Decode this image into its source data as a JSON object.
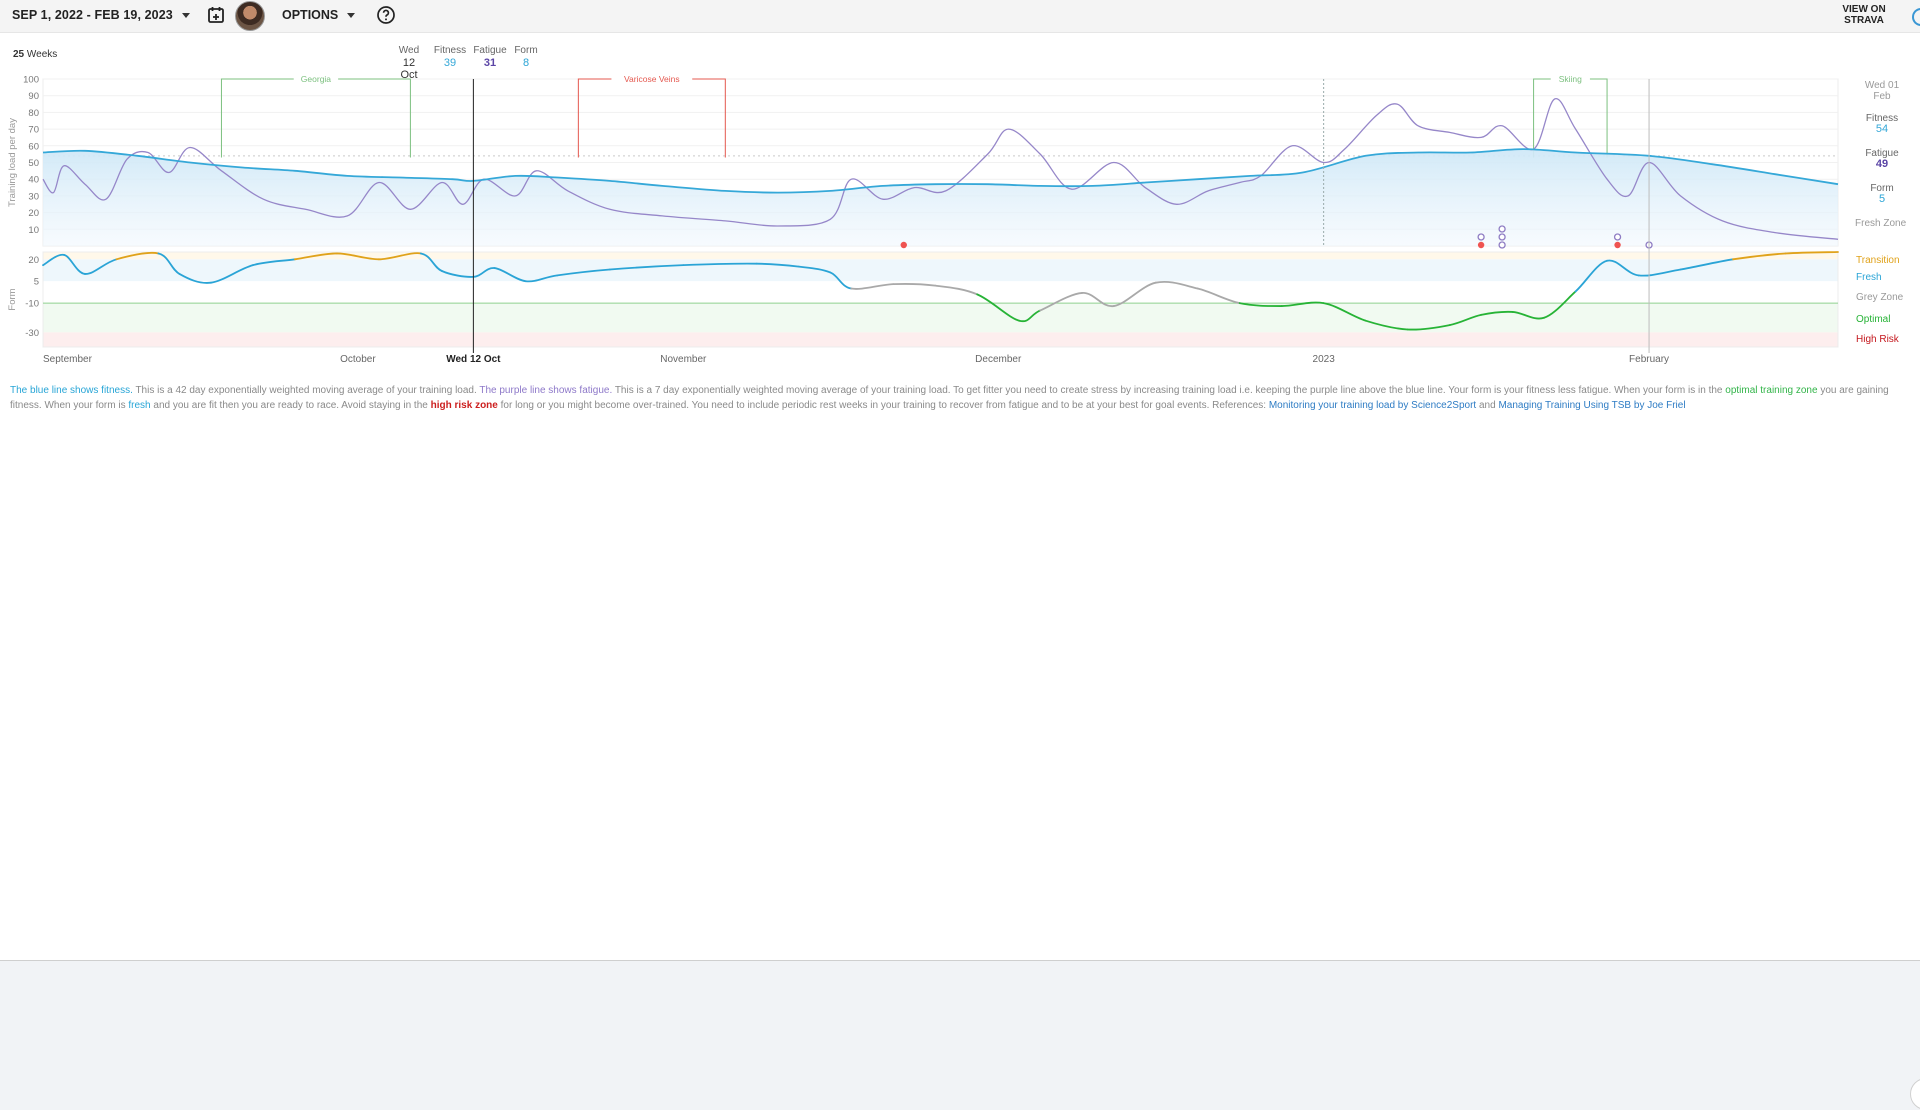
{
  "toolbar": {
    "date_range": "SEP 1, 2022 - FEB 19, 2023",
    "options_label": "OPTIONS",
    "strava_line1": "VIEW ON",
    "strava_line2": "STRAVA"
  },
  "summary": {
    "weeks_count": "25",
    "weeks_label": "Weeks"
  },
  "hover": {
    "day": "Wed",
    "date": "12 Oct",
    "fitness_label": "Fitness",
    "fitness": "39",
    "fatigue_label": "Fatigue",
    "fatigue": "31",
    "form_label": "Form",
    "form": "8",
    "axis_label": "Wed 12 Oct"
  },
  "latest": {
    "date_line1": "Wed 01",
    "date_line2": "Feb",
    "fitness_label": "Fitness",
    "fitness": "54",
    "fatigue_label": "Fatigue",
    "fatigue": "49",
    "form_label": "Form",
    "form": "5"
  },
  "zones": {
    "fresh_zone": "Fresh Zone",
    "transition": "Transition",
    "fresh": "Fresh",
    "grey": "Grey Zone",
    "optimal": "Optimal",
    "high_risk": "High Risk"
  },
  "colors": {
    "fitness": "#35a8d8",
    "fatigue": "#9687c9",
    "transition": "#e0a21a",
    "fresh": "#2aa4d6",
    "grey": "#a9a9a9",
    "optimal": "#27b336",
    "high_risk": "#c4161c",
    "event_green": "#7cc07f",
    "event_red": "#e4584f",
    "marker_red": "#ef5350",
    "marker_purple": "#8e7cc3"
  },
  "description": {
    "fitness_phrase": "The blue line shows fitness.",
    "p1": " This is a 42 day exponentially weighted moving average of your training load. ",
    "fatigue_phrase": "The purple line shows fatigue.",
    "p2": " This is a 7 day exponentially weighted moving average of your training load. To get fitter you need to create stress by increasing training load i.e. keeping the purple line above the blue line. Your form is your fitness less fatigue. When your form is in the ",
    "optimal_phrase": "optimal training zone",
    "p3": " you are gaining fitness. When your form is ",
    "fresh_phrase": "fresh",
    "p4": " and you are fit then you are ready to race. Avoid staying in the ",
    "risk_phrase": "high risk zone",
    "p5": " for long or you might become over-trained. You need to include periodic rest weeks in your training to recover from fatigue and to be at your best for goal events. References: ",
    "ref1": "Monitoring your training load by Science2Sport",
    "and": " and ",
    "ref2": "Managing Training Using TSB by Joe Friel"
  },
  "chart_data": [
    {
      "type": "line",
      "ylabel": "Training load per day",
      "ylim": [
        0,
        100
      ],
      "yticks": [
        10,
        20,
        30,
        40,
        50,
        60,
        70,
        80,
        90,
        100
      ],
      "x_start": "2022-09-01",
      "x_end": "2023-02-19",
      "month_ticks": [
        {
          "label": "September",
          "date": "2022-09-01"
        },
        {
          "label": "October",
          "date": "2022-10-01"
        },
        {
          "label": "November",
          "date": "2022-11-01"
        },
        {
          "label": "December",
          "date": "2022-12-01"
        },
        {
          "label": "2023",
          "date": "2023-01-01"
        },
        {
          "label": "February",
          "date": "2023-02-01"
        }
      ],
      "reference_line": 54,
      "hover_date": "2022-10-12",
      "latest_date": "2023-02-01",
      "events": [
        {
          "label": "Georgia",
          "start": "2022-09-18",
          "end": "2022-10-06",
          "color": "event_green"
        },
        {
          "label": "Varicose Veins",
          "start": "2022-10-22",
          "end": "2022-11-05",
          "color": "event_red"
        },
        {
          "label": "Skiing",
          "start": "2023-01-21",
          "end": "2023-01-28",
          "color": "event_green"
        }
      ],
      "markers": [
        {
          "date": "2022-11-22",
          "level": 0,
          "kind": "red"
        },
        {
          "date": "2023-01-16",
          "level": 0,
          "kind": "red"
        },
        {
          "date": "2023-01-16",
          "level": 1,
          "kind": "purple"
        },
        {
          "date": "2023-01-18",
          "level": 0,
          "kind": "purple"
        },
        {
          "date": "2023-01-18",
          "level": 1,
          "kind": "purple"
        },
        {
          "date": "2023-01-18",
          "level": 2,
          "kind": "purple"
        },
        {
          "date": "2023-01-29",
          "level": 0,
          "kind": "red"
        },
        {
          "date": "2023-01-29",
          "level": 1,
          "kind": "purple"
        },
        {
          "date": "2023-02-01",
          "level": 0,
          "kind": "purple"
        }
      ],
      "series": [
        {
          "name": "Fitness",
          "color_key": "fitness",
          "points": [
            [
              "2022-09-01",
              56
            ],
            [
              "2022-09-05",
              57
            ],
            [
              "2022-09-10",
              54
            ],
            [
              "2022-09-15",
              50
            ],
            [
              "2022-09-20",
              47
            ],
            [
              "2022-09-25",
              45
            ],
            [
              "2022-09-30",
              42
            ],
            [
              "2022-10-05",
              41
            ],
            [
              "2022-10-10",
              40
            ],
            [
              "2022-10-12",
              39
            ],
            [
              "2022-10-16",
              42
            ],
            [
              "2022-10-20",
              41
            ],
            [
              "2022-10-25",
              39
            ],
            [
              "2022-10-30",
              36
            ],
            [
              "2022-11-05",
              33
            ],
            [
              "2022-11-10",
              32
            ],
            [
              "2022-11-15",
              33
            ],
            [
              "2022-11-20",
              36
            ],
            [
              "2022-11-25",
              37
            ],
            [
              "2022-11-30",
              37
            ],
            [
              "2022-12-05",
              36
            ],
            [
              "2022-12-10",
              36
            ],
            [
              "2022-12-15",
              38
            ],
            [
              "2022-12-20",
              40
            ],
            [
              "2022-12-25",
              42
            ],
            [
              "2022-12-30",
              44
            ],
            [
              "2023-01-05",
              54
            ],
            [
              "2023-01-10",
              56
            ],
            [
              "2023-01-15",
              56
            ],
            [
              "2023-01-20",
              58
            ],
            [
              "2023-01-25",
              56
            ],
            [
              "2023-02-01",
              54
            ],
            [
              "2023-02-07",
              49
            ],
            [
              "2023-02-13",
              43
            ],
            [
              "2023-02-19",
              37
            ]
          ]
        },
        {
          "name": "Fatigue",
          "color_key": "fatigue",
          "points": [
            [
              "2022-09-01",
              40
            ],
            [
              "2022-09-02",
              32
            ],
            [
              "2022-09-03",
              48
            ],
            [
              "2022-09-05",
              37
            ],
            [
              "2022-09-07",
              28
            ],
            [
              "2022-09-09",
              52
            ],
            [
              "2022-09-11",
              56
            ],
            [
              "2022-09-13",
              44
            ],
            [
              "2022-09-15",
              59
            ],
            [
              "2022-09-18",
              45
            ],
            [
              "2022-09-22",
              28
            ],
            [
              "2022-09-26",
              22
            ],
            [
              "2022-09-30",
              18
            ],
            [
              "2022-10-03",
              38
            ],
            [
              "2022-10-06",
              22
            ],
            [
              "2022-10-09",
              38
            ],
            [
              "2022-10-11",
              25
            ],
            [
              "2022-10-13",
              40
            ],
            [
              "2022-10-16",
              30
            ],
            [
              "2022-10-18",
              45
            ],
            [
              "2022-10-21",
              33
            ],
            [
              "2022-10-25",
              22
            ],
            [
              "2022-10-30",
              18
            ],
            [
              "2022-11-05",
              15
            ],
            [
              "2022-11-10",
              12
            ],
            [
              "2022-11-15",
              16
            ],
            [
              "2022-11-17",
              40
            ],
            [
              "2022-11-20",
              28
            ],
            [
              "2022-11-23",
              35
            ],
            [
              "2022-11-26",
              33
            ],
            [
              "2022-11-30",
              55
            ],
            [
              "2022-12-02",
              70
            ],
            [
              "2022-12-05",
              55
            ],
            [
              "2022-12-08",
              34
            ],
            [
              "2022-12-12",
              50
            ],
            [
              "2022-12-15",
              35
            ],
            [
              "2022-12-18",
              25
            ],
            [
              "2022-12-21",
              33
            ],
            [
              "2022-12-24",
              38
            ],
            [
              "2022-12-26",
              42
            ],
            [
              "2022-12-29",
              60
            ],
            [
              "2023-01-01",
              50
            ],
            [
              "2023-01-03",
              58
            ],
            [
              "2023-01-06",
              78
            ],
            [
              "2023-01-08",
              85
            ],
            [
              "2023-01-10",
              72
            ],
            [
              "2023-01-13",
              68
            ],
            [
              "2023-01-16",
              65
            ],
            [
              "2023-01-18",
              72
            ],
            [
              "2023-01-21",
              58
            ],
            [
              "2023-01-23",
              88
            ],
            [
              "2023-01-25",
              70
            ],
            [
              "2023-01-28",
              40
            ],
            [
              "2023-01-30",
              30
            ],
            [
              "2023-02-01",
              50
            ],
            [
              "2023-02-04",
              30
            ],
            [
              "2023-02-08",
              15
            ],
            [
              "2023-02-13",
              8
            ],
            [
              "2023-02-19",
              4
            ]
          ]
        }
      ]
    },
    {
      "type": "line",
      "ylabel": "Form",
      "ylim": [
        -40,
        25
      ],
      "yticks": [
        20,
        5,
        -10,
        -30
      ],
      "x_start": "2022-09-01",
      "x_end": "2023-02-19",
      "zone_bands": [
        {
          "label": "Transition",
          "from": 25,
          "to": 20,
          "color_key": "transition"
        },
        {
          "label": "Fresh",
          "from": 20,
          "to": 5,
          "color_key": "fresh"
        },
        {
          "label": "Grey Zone",
          "from": 5,
          "to": -10,
          "color_key": "grey"
        },
        {
          "label": "Optimal",
          "from": -10,
          "to": -30,
          "color_key": "optimal"
        },
        {
          "label": "High Risk",
          "from": -30,
          "to": -40,
          "color_key": "high_risk"
        }
      ],
      "series": [
        {
          "name": "Form",
          "points": [
            [
              "2022-09-01",
              16
            ],
            [
              "2022-09-03",
              23
            ],
            [
              "2022-09-05",
              10
            ],
            [
              "2022-09-08",
              20
            ],
            [
              "2022-09-12",
              24
            ],
            [
              "2022-09-14",
              10
            ],
            [
              "2022-09-17",
              4
            ],
            [
              "2022-09-21",
              16
            ],
            [
              "2022-09-25",
              20
            ],
            [
              "2022-09-29",
              24
            ],
            [
              "2022-10-03",
              20
            ],
            [
              "2022-10-07",
              24
            ],
            [
              "2022-10-09",
              12
            ],
            [
              "2022-10-12",
              8
            ],
            [
              "2022-10-14",
              14
            ],
            [
              "2022-10-17",
              5
            ],
            [
              "2022-10-20",
              9
            ],
            [
              "2022-10-25",
              13
            ],
            [
              "2022-11-01",
              16
            ],
            [
              "2022-11-08",
              17
            ],
            [
              "2022-11-12",
              15
            ],
            [
              "2022-11-15",
              11
            ],
            [
              "2022-11-17",
              0
            ],
            [
              "2022-11-21",
              3
            ],
            [
              "2022-11-25",
              2
            ],
            [
              "2022-11-29",
              -4
            ],
            [
              "2022-12-03",
              -22
            ],
            [
              "2022-12-05",
              -15
            ],
            [
              "2022-12-09",
              -3
            ],
            [
              "2022-12-12",
              -12
            ],
            [
              "2022-12-16",
              4
            ],
            [
              "2022-12-20",
              0
            ],
            [
              "2022-12-24",
              -10
            ],
            [
              "2022-12-28",
              -12
            ],
            [
              "2023-01-01",
              -10
            ],
            [
              "2023-01-05",
              -22
            ],
            [
              "2023-01-09",
              -28
            ],
            [
              "2023-01-13",
              -25
            ],
            [
              "2023-01-16",
              -18
            ],
            [
              "2023-01-19",
              -16
            ],
            [
              "2023-01-22",
              -20
            ],
            [
              "2023-01-25",
              -2
            ],
            [
              "2023-01-28",
              19
            ],
            [
              "2023-01-31",
              9
            ],
            [
              "2023-02-04",
              13
            ],
            [
              "2023-02-09",
              20
            ],
            [
              "2023-02-14",
              24
            ],
            [
              "2023-02-19",
              25
            ]
          ]
        }
      ]
    }
  ]
}
